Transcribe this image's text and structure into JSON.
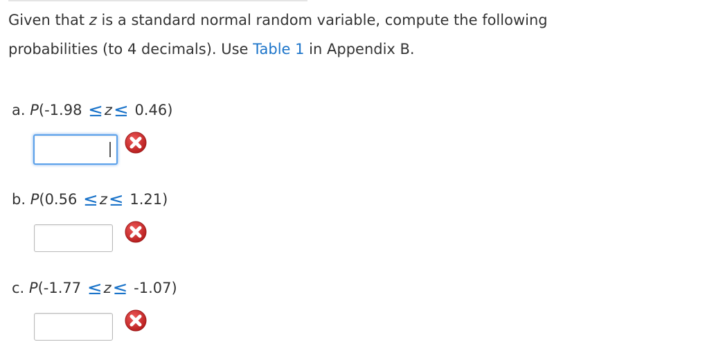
{
  "intro": {
    "line1_prefix": "Given that ",
    "variable": "z",
    "line1_suffix": " is a standard normal random variable, compute the following",
    "line2_prefix": "probabilities (to 4 decimals). Use ",
    "table_link": "Table 1",
    "line2_suffix": " in Appendix B."
  },
  "parts": [
    {
      "letter": "a.",
      "p": "P",
      "lower": "(-1.98",
      "variable": "z",
      "upper": "0.46)",
      "input_value": "",
      "status": "wrong-icon"
    },
    {
      "letter": "b.",
      "p": "P",
      "lower": "(0.56",
      "variable": "z",
      "upper": "1.21)",
      "input_value": "",
      "status": "wrong-icon"
    },
    {
      "letter": "c.",
      "p": "P",
      "lower": "(-1.77",
      "variable": "z",
      "upper": "-1.07)",
      "input_value": "",
      "status": "wrong-icon"
    }
  ],
  "symbols": {
    "leq": "≤"
  },
  "colors": {
    "link": "#1a73c9",
    "wrong_red": "#d42e2e",
    "focus_blue": "#5aa0ea"
  }
}
